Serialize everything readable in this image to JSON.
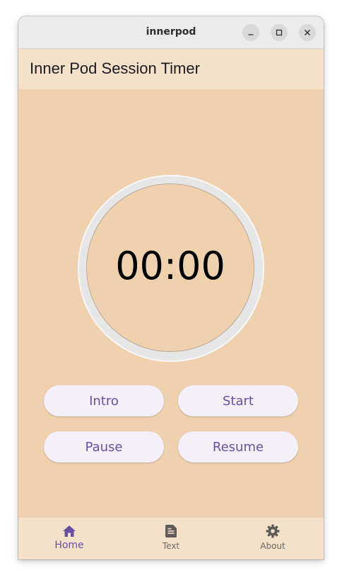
{
  "window": {
    "title": "innerpod",
    "controls": {
      "minimize_icon": "minimize-icon",
      "maximize_icon": "maximize-icon",
      "close_icon": "close-icon"
    }
  },
  "appbar": {
    "title": "Inner Pod Session Timer"
  },
  "timer": {
    "display": "00:00",
    "progress": 0
  },
  "buttons": {
    "intro": "Intro",
    "start": "Start",
    "pause": "Pause",
    "resume": "Resume"
  },
  "nav": {
    "selected": "Home",
    "items": [
      {
        "label": "Home",
        "icon": "home-icon",
        "active": true
      },
      {
        "label": "Text",
        "icon": "document-icon",
        "active": false
      },
      {
        "label": "About",
        "icon": "gear-icon",
        "active": false
      }
    ]
  },
  "colors": {
    "background": "#efd1af",
    "appbar": "#f4e1c9",
    "accent": "#6750a4",
    "button_fill": "#f5eff7",
    "ring": "#e6e6e6"
  }
}
